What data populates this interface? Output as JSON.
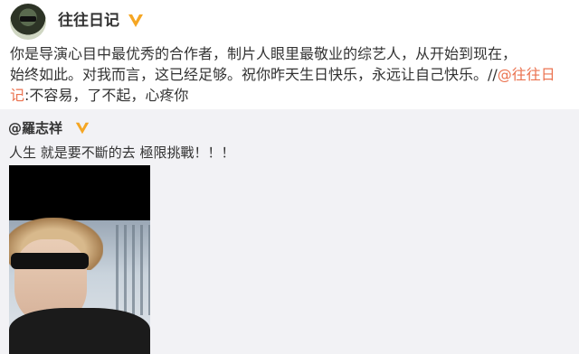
{
  "post": {
    "author": "往往日记",
    "line1": "你是导演心目中最优秀的合作者，制片人眼里最敬业的综艺人，从开始到现在，",
    "line2": "始终如此。对我而言，这已经足够。祝你昨天生日快乐，永远让自己快乐。//",
    "mention": "@往往日记",
    "line3": ":不容易，了不起，心疼你"
  },
  "repost": {
    "author": "@羅志祥",
    "text": "人生 就是要不斷的去 極限挑戰！！！"
  },
  "colors": {
    "mention": "#eb7350",
    "badge": "#f5a623",
    "repost_bg": "#f2f2f5"
  }
}
